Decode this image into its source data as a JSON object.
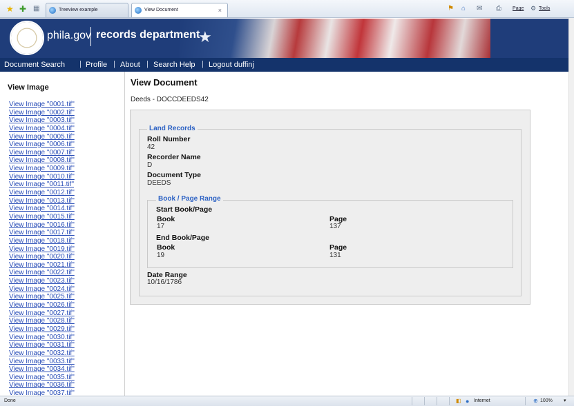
{
  "browser": {
    "tabs": [
      {
        "label": "Treeview example"
      },
      {
        "label": "View Document",
        "close": "×"
      }
    ],
    "toolbar": {
      "page_label": "Page",
      "tools_label": "Tools"
    }
  },
  "header": {
    "site_name": "phila.gov",
    "department": "records department"
  },
  "nav": {
    "items": [
      "Document Search",
      "Profile",
      "About",
      "Search Help",
      "Logout duffinj"
    ],
    "separator": "|"
  },
  "sidebar": {
    "title": "View Image",
    "links": [
      "View Image \"0001.tif\"",
      "View Image \"0002.tif\"",
      "View Image \"0003.tif\"",
      "View Image \"0004.tif\"",
      "View Image \"0005.tif\"",
      "View Image \"0006.tif\"",
      "View Image \"0007.tif\"",
      "View Image \"0008.tif\"",
      "View Image \"0009.tif\"",
      "View Image \"0010.tif\"",
      "View Image \"0011.tif\"",
      "View Image \"0012.tif\"",
      "View Image \"0013.tif\"",
      "View Image \"0014.tif\"",
      "View Image \"0015.tif\"",
      "View Image \"0016.tif\"",
      "View Image \"0017.tif\"",
      "View Image \"0018.tif\"",
      "View Image \"0019.tif\"",
      "View Image \"0020.tif\"",
      "View Image \"0021.tif\"",
      "View Image \"0022.tif\"",
      "View Image \"0023.tif\"",
      "View Image \"0024.tif\"",
      "View Image \"0025.tif\"",
      "View Image \"0026.tif\"",
      "View Image \"0027.tif\"",
      "View Image \"0028.tif\"",
      "View Image \"0029.tif\"",
      "View Image \"0030.tif\"",
      "View Image \"0031.tif\"",
      "View Image \"0032.tif\"",
      "View Image \"0033.tif\"",
      "View Image \"0034.tif\"",
      "View Image \"0035.tif\"",
      "View Image \"0036.tif\"",
      "View Image \"0037.tif\""
    ]
  },
  "main": {
    "title": "View Document",
    "subtitle": "Deeds - DOCCDEEDS42",
    "land_records": {
      "legend": "Land Records",
      "roll_number_label": "Roll Number",
      "roll_number": "42",
      "recorder_name_label": "Recorder Name",
      "recorder_name": "D",
      "document_type_label": "Document Type",
      "document_type": "DEEDS",
      "date_range_label": "Date Range",
      "date_range": "10/16/1786"
    },
    "book_page_range": {
      "legend": "Book / Page Range",
      "start_label": "Start Book/Page",
      "start_book_label": "Book",
      "start_book": "17",
      "start_page_label": "Page",
      "start_page": "137",
      "end_label": "End Book/Page",
      "end_book_label": "Book",
      "end_book": "19",
      "end_page_label": "Page",
      "end_page": "131"
    }
  },
  "statusbar": {
    "status": "Done",
    "zone": "Internet",
    "zoom": "100%"
  },
  "colors": {
    "nav_bg": "#14336b",
    "banner_bg": "#1f3d7a",
    "link": "#2b4fb8",
    "legend": "#2d62c4",
    "panel_bg": "#eeeeee"
  }
}
